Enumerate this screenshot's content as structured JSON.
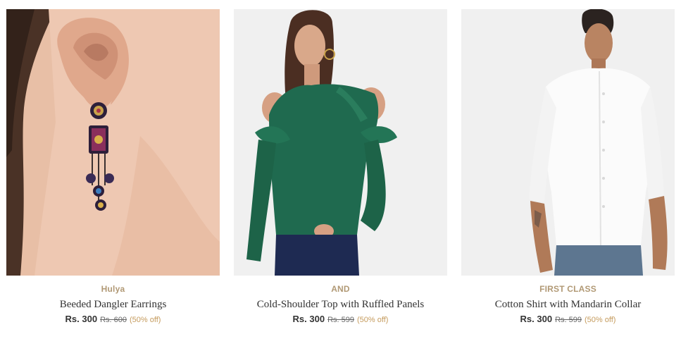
{
  "products": [
    {
      "brand": "Hulya",
      "title": "Beeded Dangler Earrings",
      "price": "Rs. 300",
      "mrp": "Rs. 600",
      "discount": "(50% off)",
      "image": "earring-photo"
    },
    {
      "brand": "AND",
      "title": "Cold-Shoulder Top with Ruffled Panels",
      "price": "Rs. 300",
      "mrp": "Rs. 599",
      "discount": "(50% off)",
      "image": "green-top-photo"
    },
    {
      "brand": "FIRST CLASS",
      "title": "Cotton Shirt with Mandarin Collar",
      "price": "Rs. 300",
      "mrp": "Rs. 599",
      "discount": "(50% off)",
      "image": "white-shirt-photo"
    }
  ],
  "colors": {
    "brand": "#b19975",
    "discount": "#c59b5d",
    "text": "#333333"
  }
}
